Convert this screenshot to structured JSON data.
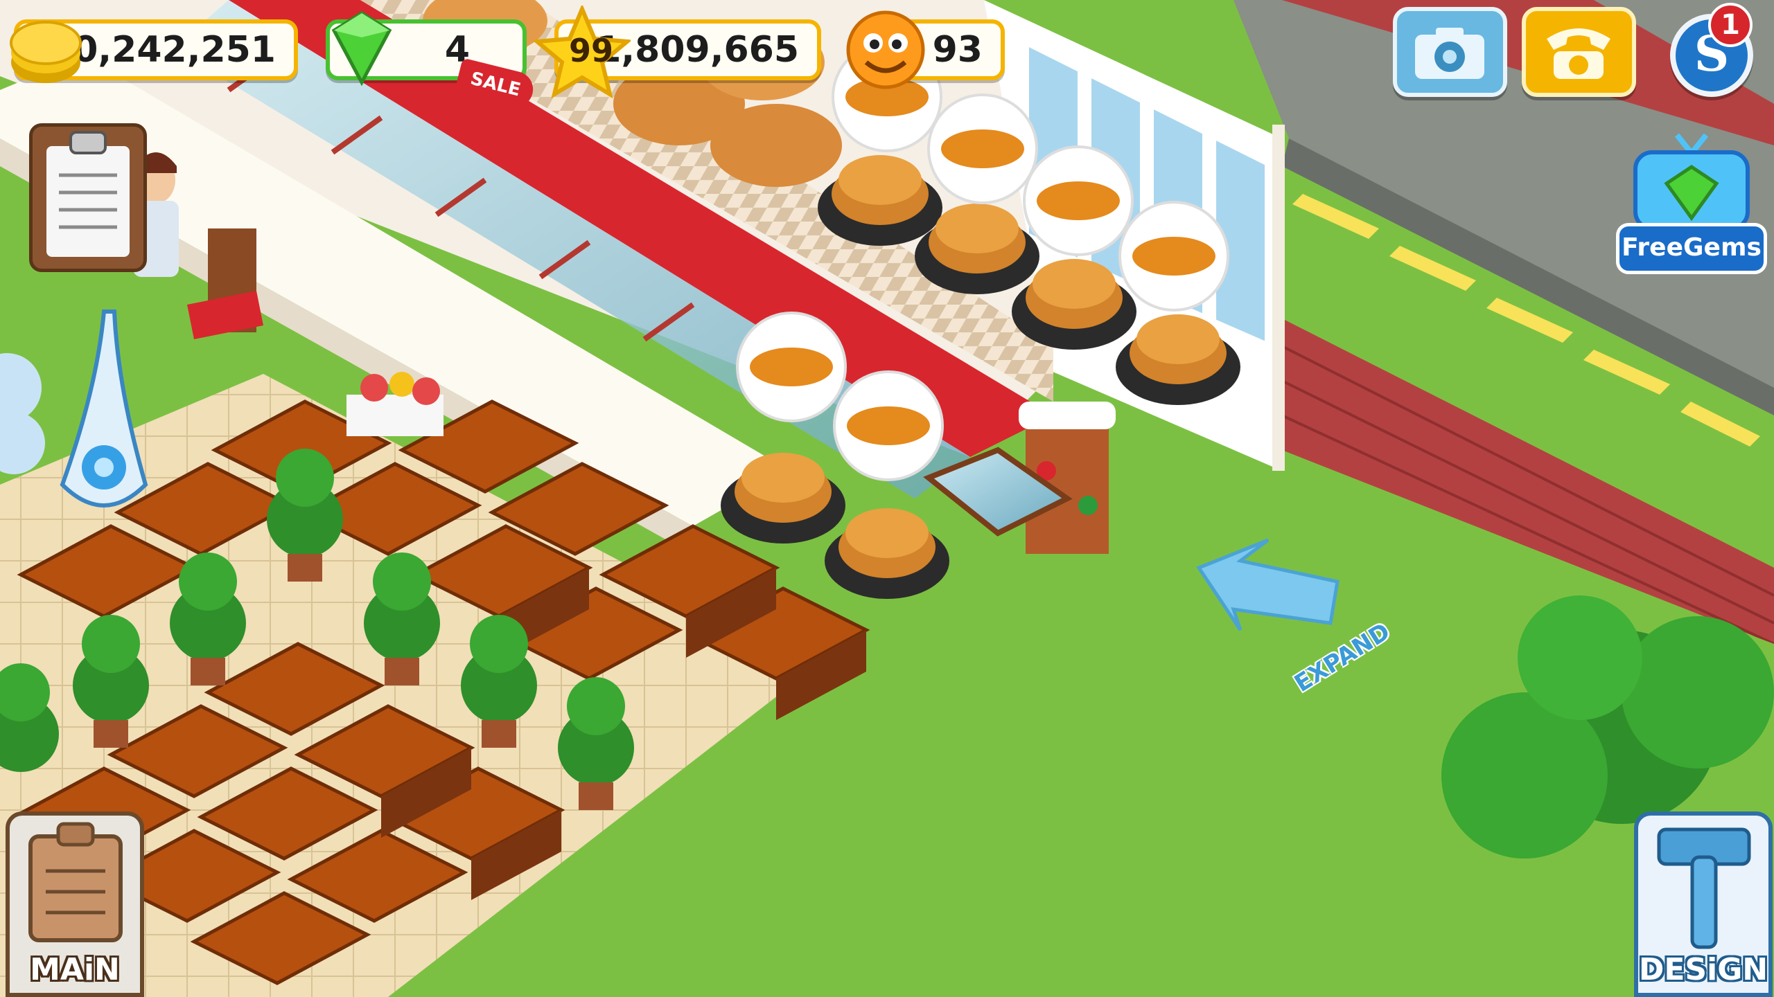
{
  "hud": {
    "coins": "30,242,251",
    "gems": "4",
    "level": "99",
    "experience": "1,809,665",
    "happiness": "93"
  },
  "sale_tag": "SALE",
  "top_buttons": {
    "camera_icon": "camera-icon",
    "phone_icon": "phone-icon",
    "social_icon": "social-icon",
    "notification_count": "1"
  },
  "free_gems": {
    "label": "FreeGems"
  },
  "expand": {
    "label": "EXPAND"
  },
  "bottom": {
    "main_label": "MAiN",
    "design_label": "DESiGN"
  },
  "colors": {
    "coin": "#f5c518",
    "gem": "#4cd137",
    "star": "#ffd21a",
    "grass": "#7cc043",
    "counter_red": "#d8262e",
    "table_wood": "#b6500f",
    "road": "#8a8f88",
    "brick": "#b44141"
  }
}
